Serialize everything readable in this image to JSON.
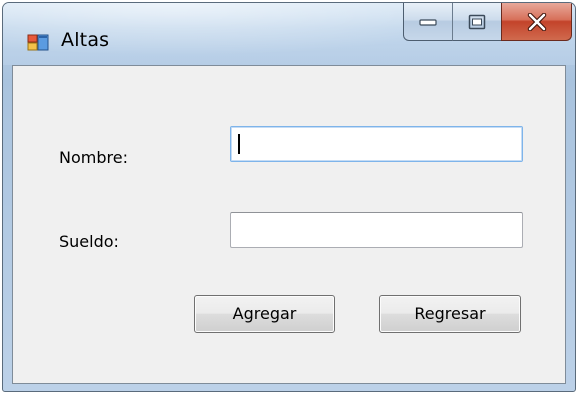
{
  "window": {
    "title": "Altas",
    "icon": "windows-form-icon",
    "caption_buttons": [
      "minimize-icon",
      "maximize-icon",
      "close-icon"
    ]
  },
  "form": {
    "nombre_label": "Nombre:",
    "nombre_value": "",
    "sueldo_label": "Sueldo:",
    "sueldo_value": "",
    "agregar_label": "Agregar",
    "regresar_label": "Regresar"
  },
  "colors": {
    "client_background": "#f0f0f0",
    "close_button": "#c3432a",
    "focused_border": "#7eb4ea"
  }
}
